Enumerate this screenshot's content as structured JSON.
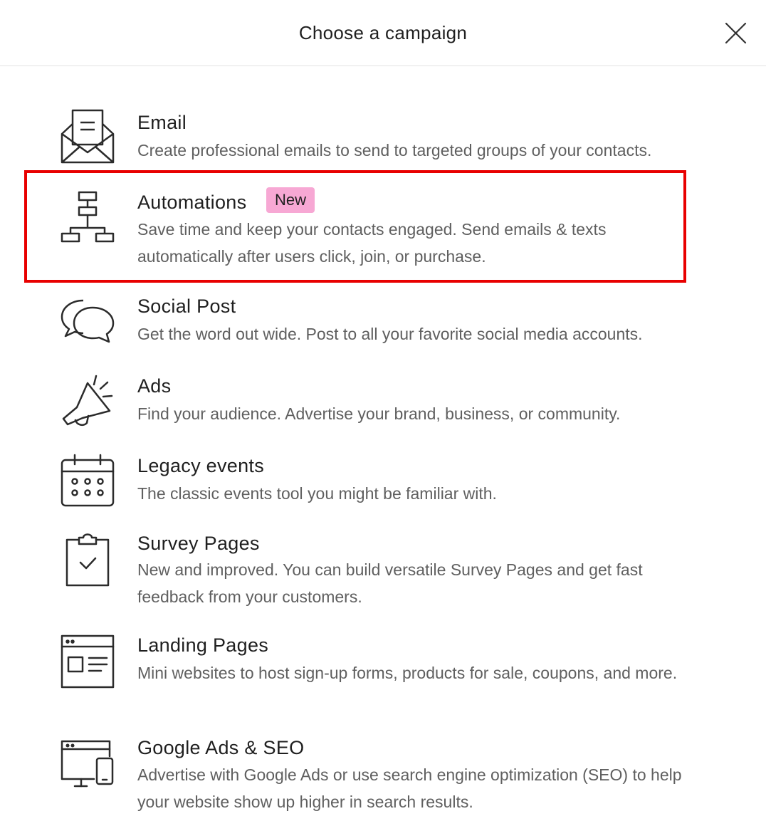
{
  "header": {
    "title": "Choose a campaign",
    "close_icon": "close-icon"
  },
  "options": [
    {
      "id": "email",
      "title": "Email",
      "description": "Create professional emails to send to targeted groups of your contacts.",
      "icon": "envelope-icon"
    },
    {
      "id": "automations",
      "title": "Automations",
      "badge": "New",
      "badge_color": "#f7a8d4",
      "description": "Save time and keep your contacts engaged. Send emails & texts automatically after users click, join, or purchase.",
      "icon": "flowchart-icon",
      "highlighted": true,
      "highlight_color": "#e80000"
    },
    {
      "id": "social-post",
      "title": "Social Post",
      "description": "Get the word out wide. Post to all your favorite social media accounts.",
      "icon": "chat-bubbles-icon"
    },
    {
      "id": "ads",
      "title": "Ads",
      "description": "Find your audience. Advertise your brand, business, or community.",
      "icon": "megaphone-icon"
    },
    {
      "id": "legacy-events",
      "title": "Legacy events",
      "description": "The classic events tool you might be familiar with.",
      "icon": "calendar-icon"
    },
    {
      "id": "survey-pages",
      "title": "Survey Pages",
      "description": "New and improved. You can build versatile Survey Pages and get fast feedback from your customers.",
      "icon": "clipboard-check-icon"
    },
    {
      "id": "landing-pages",
      "title": "Landing Pages",
      "description": "Mini websites to host sign-up forms, products for sale, coupons, and more.",
      "icon": "webpage-icon"
    },
    {
      "id": "google-ads-seo",
      "title": "Google Ads & SEO",
      "description": "Advertise with Google Ads or use search engine optimization (SEO) to help your website show up higher in search results.",
      "icon": "devices-icon"
    }
  ]
}
